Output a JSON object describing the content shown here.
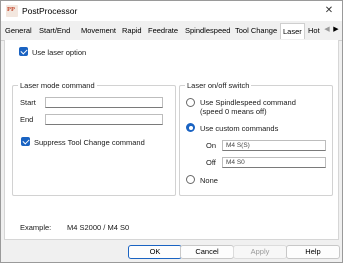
{
  "window": {
    "title": "PostProcessor",
    "icon": "postprocessor-app-icon"
  },
  "tabs": [
    "General",
    "Start/End",
    "Movement",
    "Rapid",
    "Feedrate",
    "Spindlespeed",
    "Tool Change",
    "Laser",
    "Hot"
  ],
  "active_tab": "Laser",
  "laser": {
    "use_laser_label": "Use laser option",
    "use_laser_checked": true,
    "mode_group_title": "Laser mode command",
    "start_label": "Start",
    "start_value": "",
    "end_label": "End",
    "end_value": "",
    "suppress_label": "Suppress Tool Change command",
    "suppress_checked": true,
    "switch_group_title": "Laser on/off switch",
    "opt_spindle_line1": "Use Spindlespeed command",
    "opt_spindle_line2": "(speed 0 means off)",
    "opt_custom": "Use custom commands",
    "opt_none": "None",
    "selected_option": "custom",
    "on_label": "On",
    "on_value": "M4 S(S)",
    "off_label": "Off",
    "off_value": "M4 S0",
    "example_label": "Example:",
    "example_value": "M4 S2000   /   M4 S0"
  },
  "buttons": {
    "ok": "OK",
    "cancel": "Cancel",
    "apply": "Apply",
    "help": "Help"
  },
  "colors": {
    "accent": "#1a63c2",
    "panel": "#ffffff",
    "window": "#f0f0f0"
  }
}
